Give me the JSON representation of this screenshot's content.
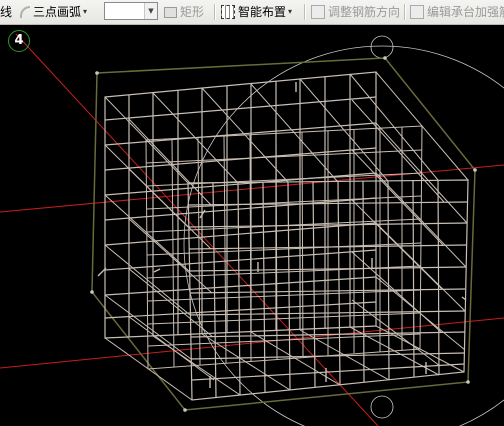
{
  "toolbar": {
    "line_label": "线",
    "arc_label": "三点画弧",
    "combo_value": "",
    "rect_label": "矩形",
    "smart_layout_label": "智能布置",
    "adjust_rebar_label": "调整钢筋方向",
    "edit_cap_label": "编辑承台加强筋"
  },
  "viewport": {
    "axis_number": "4",
    "background": "#000000",
    "rebar_color": "#c8beb4",
    "frame_color": "#6a6a3a",
    "axis_color": "#c81e1e"
  }
}
